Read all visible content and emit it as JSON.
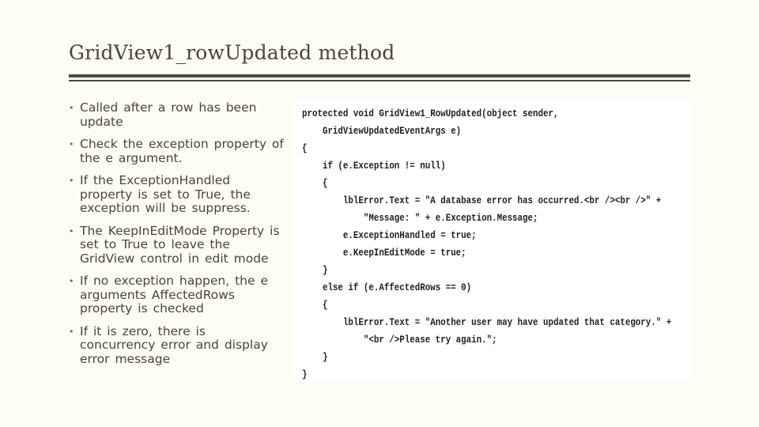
{
  "slide": {
    "title": "GridView1_rowUpdated method",
    "bullets": [
      "Called after a row has been update",
      "Check the exception property of the e argument.",
      "If the ExceptionHandled property is set to True, the exception will be suppress.",
      "The  KeepInEditMode Property is set to True to leave the GridView control in edit mode",
      "If no exception happen, the e arguments AffectedRows property is checked",
      "If it is zero, there is concurrency error and display error message"
    ],
    "code_lines": [
      "protected void GridView1_RowUpdated(object sender,",
      "    GridViewUpdatedEventArgs e)",
      "{",
      "    if (e.Exception != null)",
      "    {",
      "        lblError.Text = \"A database error has occurred.<br /><br />\" +",
      "            \"Message: \" + e.Exception.Message;",
      "        e.ExceptionHandled = true;",
      "        e.KeepInEditMode = true;",
      "    }",
      "    else if (e.AffectedRows == 0)",
      "    {",
      "        lblError.Text = \"Another user may have updated that category.\" +",
      "            \"<br />Please try again.\";",
      "    }",
      "}"
    ],
    "bullet_glyph": "•"
  },
  "colors": {
    "background": "#fdfdf3",
    "text": "#4a4537",
    "rule": "#4d493e",
    "code_background": "#ffffff"
  }
}
